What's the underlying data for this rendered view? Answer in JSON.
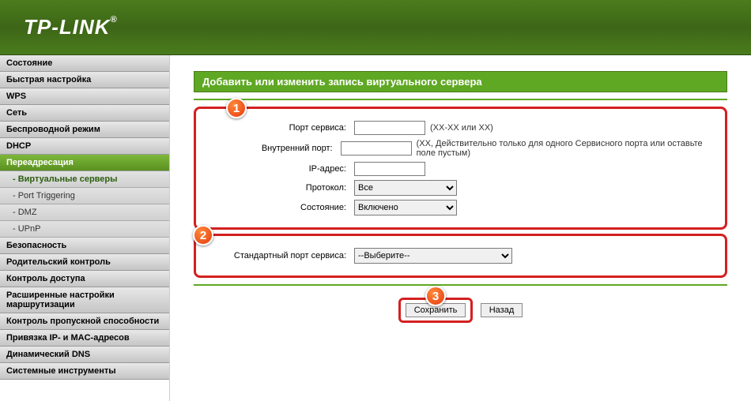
{
  "brand": "TP-LINK",
  "menu": {
    "items": [
      "Состояние",
      "Быстрая настройка",
      "WPS",
      "Сеть",
      "Беспроводной режим",
      "DHCP",
      "Переадресация",
      "Безопасность",
      "Родительский контроль",
      "Контроль доступа",
      "Расширенные настройки маршрутизации",
      "Контроль пропускной способности",
      "Привязка IP- и MAC-адресов",
      "Динамический DNS",
      "Системные инструменты"
    ],
    "sub": [
      "- Виртуальные серверы",
      "- Port Triggering",
      "- DMZ",
      "- UPnP"
    ]
  },
  "page": {
    "title": "Добавить или изменить запись виртуального сервера",
    "labels": {
      "servicePort": "Порт сервиса:",
      "internalPort": "Внутренний порт:",
      "ipAddress": "IP-адрес:",
      "protocol": "Протокол:",
      "status": "Состояние:",
      "commonPort": "Стандартный порт сервиса:"
    },
    "hints": {
      "servicePort": "(XX-XX или XX)",
      "internalPort": "(XX, Действительно только для одного Сервисного порта или оставьте поле пустым)"
    },
    "selects": {
      "protocol": "Все",
      "status": "Включено",
      "commonPort": "--Выберите--"
    },
    "buttons": {
      "save": "Сохранить",
      "back": "Назад"
    },
    "badges": {
      "one": "1",
      "two": "2",
      "three": "3"
    }
  }
}
